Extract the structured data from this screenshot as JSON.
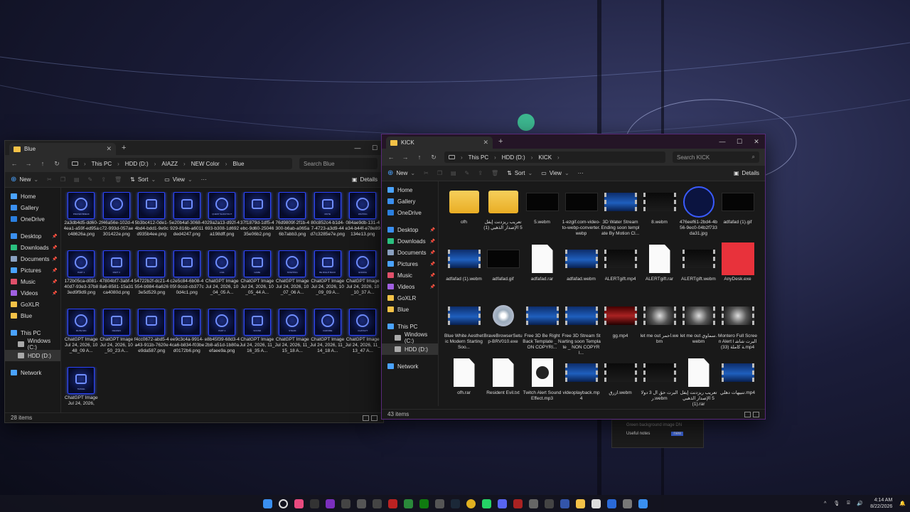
{
  "colors": {
    "accent": "#4aa3ff",
    "folder": "#f4c247",
    "neon": "#2b43ff"
  },
  "left_window": {
    "tab_title": "Blue",
    "breadcrumb": [
      "This PC",
      "HDD (D:)",
      "AIAZZ",
      "NEW Color",
      "Blue"
    ],
    "search_placeholder": "Search Blue",
    "commands": {
      "new": "New",
      "sort": "Sort",
      "view": "View",
      "details": "Details"
    },
    "sidebar": [
      "Home",
      "Gallery",
      "OneDrive",
      "Desktop",
      "Downloads",
      "Documents",
      "Pictures",
      "Music",
      "Videos",
      "GoXLR",
      "Blue",
      "This PC",
      "Windows (C:)",
      "HDD (D:)",
      "Network"
    ],
    "items": [
      {
        "label": "2a3db4d5-dd60-4ea1-a59f-ed95ac48626a.png",
        "cap": "PRAYER BREAK",
        "shape": "ring"
      },
      {
        "label": "2f46a56e-102d-4c72-993d-057ae301422e.png",
        "cap": "",
        "shape": "ring"
      },
      {
        "label": "5b3bc412-0de1-4bd4-bdd1-9e9cd935b4ee.png",
        "cap": "",
        "shape": "sq"
      },
      {
        "label": "5e20b4af-3068-4929-816b-a6011ded4247.png",
        "cap": "",
        "shape": "sq"
      },
      {
        "label": "029a2a13-d92f-4693-b308-1d692a198dff.png",
        "cap": "QUEST SHOUTOUT",
        "shape": "ring"
      },
      {
        "label": "37f1879d-1df5-4ebc-9d60-2504635e06b2.png",
        "cap": "",
        "shape": "sq"
      },
      {
        "label": "76d9809f-2f1b-4300-b6ab-a065a6b7abb3.png",
        "cap": "",
        "shape": "ring"
      },
      {
        "label": "80c852c4-b1d4-7-4723-a3d9-44d7c3285e7e.png",
        "cap": "MUTE",
        "shape": "sq"
      },
      {
        "label": "084ae9db-131-4e34-b44f-e78e89134e13.png",
        "cap": "WAITING",
        "shape": "ring"
      },
      {
        "label": "172b05ca-d081-40d7-93e3-37b83ed9f9d9.png",
        "cap": "PART 1",
        "shape": "ring"
      },
      {
        "label": "47804bf7-3abf-48a6-8581-15a31ca4080d.png",
        "cap": "PART 3",
        "shape": "sq"
      },
      {
        "label": "54722b2f-dc21-4554-b984-6a6263e5d529.png",
        "cap": "",
        "shape": "sq"
      },
      {
        "label": "c2e5c84-6b08-405f-9ccd-cb377c0d4c1.png",
        "cap": "",
        "shape": "sq"
      },
      {
        "label": "ChatGPT Image Jul 24, 2026, 10_04_05 A...",
        "cap": "LIVE",
        "shape": "ring"
      },
      {
        "label": "ChatGPT Image Jul 24, 2026, 10_05_44 A...",
        "cap": "GAME",
        "shape": "sq"
      },
      {
        "label": "ChatGPT Image Jul 24, 2026, 10_07_06 A...",
        "cap": "STARTING",
        "shape": "ring"
      },
      {
        "label": "ChatGPT Image Jul 24, 2026, 10_09_09 A...",
        "cap": "BE RIGHT BACK",
        "shape": "sq"
      },
      {
        "label": "ChatGPT Image Jul 24, 2026, 10_10_37 A...",
        "cap": "ENDING",
        "shape": "ring"
      },
      {
        "label": "ChatGPT Image Jul 24, 2026, 10_48_09 A...",
        "cap": "MUTE MIC",
        "shape": "ring"
      },
      {
        "label": "ChatGPT Image Jul 24, 2026, 10_50_23 A...",
        "cap": "DEAFEN",
        "shape": "sq"
      },
      {
        "label": "f4cc0672-abd5-4a43-911b-7620ee9da587.png",
        "cap": "",
        "shape": "sq"
      },
      {
        "label": "ee9c3c4a-9914-4ca6-b834-f03bed0172b6.png",
        "cap": "",
        "shape": "sq"
      },
      {
        "label": "e8b45f39-68d3-42b8-a51d-1b80aefaee9a.png",
        "cap": "PART 2",
        "shape": "ring"
      },
      {
        "label": "ChatGPT Image Jul 24, 2026, 11_16_35 A...",
        "cap": "SOUND",
        "shape": "sq"
      },
      {
        "label": "ChatGPT Image Jul 24, 2026, 11_15_18 A...",
        "cap": "STEAM",
        "shape": "ring"
      },
      {
        "label": "ChatGPT Image Jul 24, 2026, 11_14_18 A...",
        "cap": "CHROME",
        "shape": "ring"
      },
      {
        "label": "ChatGPT Image Jul 24, 2026, 11_13_47 A...",
        "cap": "CHATGPT",
        "shape": "ring"
      },
      {
        "label": "ChatGPT Image Jul 24, 2026,",
        "cap": "TRAVEL",
        "shape": "sq"
      }
    ],
    "status": "28 items"
  },
  "right_window": {
    "tab_title": "KICK",
    "breadcrumb": [
      "This PC",
      "HDD (D:)",
      "KICK"
    ],
    "search_placeholder": "Search KICK",
    "commands": {
      "new": "New",
      "sort": "Sort",
      "view": "View",
      "details": "Details"
    },
    "sidebar": [
      "Home",
      "Gallery",
      "OneDrive",
      "Desktop",
      "Downloads",
      "Documents",
      "Pictures",
      "Music",
      "Videos",
      "GoXLR",
      "Blue",
      "This PC",
      "Windows (C:)",
      "HDD (D:)",
      "Network"
    ],
    "items": [
      {
        "label": "ofh",
        "kind": "folder"
      },
      {
        "label": "تعريب ريزدنت إيفل 5 الإصدار الذهبي (1)",
        "kind": "folder"
      },
      {
        "label": "5.webm",
        "kind": "black"
      },
      {
        "label": "1-ezgif.com-video-to-webp-converter.webp",
        "kind": "black"
      },
      {
        "label": "3D Water Stream Ending soon template By Motion Cl...",
        "kind": "video"
      },
      {
        "label": "8.webm",
        "kind": "video-dark"
      },
      {
        "label": "476eef61-2bd4-4b56-9ec0-04b2f733da31.jpg",
        "kind": "logo"
      },
      {
        "label": "adfafad (1).gif",
        "kind": "black"
      },
      {
        "label": "adfafad (1).webm",
        "kind": "video"
      },
      {
        "label": "adfafad.gif",
        "kind": "black"
      },
      {
        "label": "adfafad.rar",
        "kind": "doc"
      },
      {
        "label": "adfafad.webm",
        "kind": "video"
      },
      {
        "label": "ALERTgift.mp4",
        "kind": "video-dark"
      },
      {
        "label": "ALERTgift.rar",
        "kind": "doc"
      },
      {
        "label": "ALERTgift.webm",
        "kind": "video-dark"
      },
      {
        "label": "AnyDesk.exe",
        "kind": "anydesk"
      },
      {
        "label": "Blue White Aesthetic Modern Starting Soo...",
        "kind": "video"
      },
      {
        "label": "BraveBrowserSetup-BRV010.exe",
        "kind": "cd"
      },
      {
        "label": "Free 3D Be Right Back Template _ NON COPYRI...",
        "kind": "video"
      },
      {
        "label": "Free 3D Stream Starting soon Template _ NON COPYRI...",
        "kind": "video"
      },
      {
        "label": "gg.mp4",
        "kind": "video-red"
      },
      {
        "label": "let me out احمر.webm",
        "kind": "video-smoke"
      },
      {
        "label": "let me out سماوي.webm",
        "kind": "video-smoke"
      },
      {
        "label": "Montero Full Screen Alert l البرت شاشة كاملة (33).mp4",
        "kind": "video-smoke"
      },
      {
        "label": "ofh.rar",
        "kind": "doc"
      },
      {
        "label": "Resident Evil.txt",
        "kind": "doc"
      },
      {
        "label": "Twitch Alert Sound Effect.mp3",
        "kind": "media"
      },
      {
        "label": "videoplayback.mp4",
        "kind": "video"
      },
      {
        "label": "ازرق.webm",
        "kind": "video-dark"
      },
      {
        "label": "البرت حق ال 3 دولار.webm",
        "kind": "video-dark"
      },
      {
        "label": "تعريب ريزدنت إيفل 5 الإصدار الذهبي (1).rar",
        "kind": "doc"
      },
      {
        "label": "تنبيهات دهلي.mp4",
        "kind": "video"
      }
    ],
    "status": "43 items"
  },
  "taskbar": {
    "time": "4:14 AM",
    "date": "8/22/2026"
  },
  "behind_window": {
    "row1": "Green background image DN",
    "row2": "Useful notes",
    "badge": "new"
  }
}
